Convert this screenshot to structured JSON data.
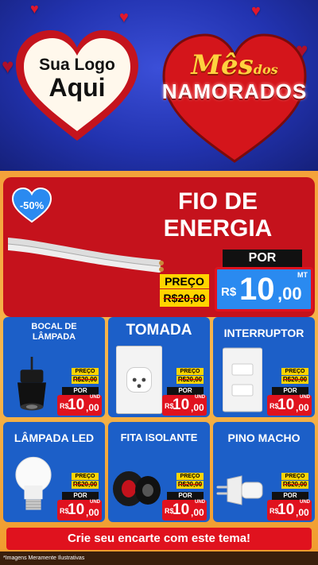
{
  "header": {
    "logo_line1": "Sua Logo",
    "logo_line2": "Aqui",
    "title_mes": "Mês",
    "title_dos": "dos",
    "title_namorados": "NAMORADOS"
  },
  "main_offer": {
    "badge": "-50%",
    "title_line1": "FIO DE",
    "title_line2": "ENERGIA",
    "preco_label": "PREÇO",
    "old_price": "R$20,00",
    "por_label": "POR",
    "currency": "R$",
    "price_int": "10",
    "price_cents": ",00",
    "unit": "MT"
  },
  "products": [
    {
      "name": "BOCAL DE LÂMPADA",
      "icon": "lamp-socket-icon",
      "preco_label": "PREÇO",
      "old_price": "R$20,00",
      "por_label": "POR",
      "currency": "R$",
      "price_int": "10",
      "price_cents": ",00",
      "unit": "UND"
    },
    {
      "name": "TOMADA",
      "icon": "power-outlet-icon",
      "preco_label": "PREÇO",
      "old_price": "R$20,00",
      "por_label": "POR",
      "currency": "R$",
      "price_int": "10",
      "price_cents": ",00",
      "unit": "UND"
    },
    {
      "name": "INTERRUPTOR",
      "icon": "light-switch-icon",
      "preco_label": "PREÇO",
      "old_price": "R$20,00",
      "por_label": "POR",
      "currency": "R$",
      "price_int": "10",
      "price_cents": ",00",
      "unit": "UND"
    },
    {
      "name": "LÂMPADA LED",
      "icon": "led-bulb-icon",
      "preco_label": "PREÇO",
      "old_price": "R$20,00",
      "por_label": "POR",
      "currency": "R$",
      "price_int": "10",
      "price_cents": ",00",
      "unit": "UND"
    },
    {
      "name": "FITA ISOLANTE",
      "icon": "insulating-tape-icon",
      "preco_label": "PREÇO",
      "old_price": "R$20,00",
      "por_label": "POR",
      "currency": "R$",
      "price_int": "10",
      "price_cents": ",00",
      "unit": "UND"
    },
    {
      "name": "PINO MACHO",
      "icon": "plug-icon",
      "preco_label": "PREÇO",
      "old_price": "R$20,00",
      "por_label": "POR",
      "currency": "R$",
      "price_int": "10",
      "price_cents": ",00",
      "unit": "UND"
    }
  ],
  "cta": "Crie seu encarte com este tema!",
  "footnote": "*Imagens Meramente Ilustrativas",
  "colors": {
    "header_blue": "#2233b0",
    "offer_red": "#c5121c",
    "card_blue": "#1c5fc8",
    "price_red": "#e0121e",
    "label_yellow": "#ffd400",
    "background_orange": "#f4a23a"
  }
}
